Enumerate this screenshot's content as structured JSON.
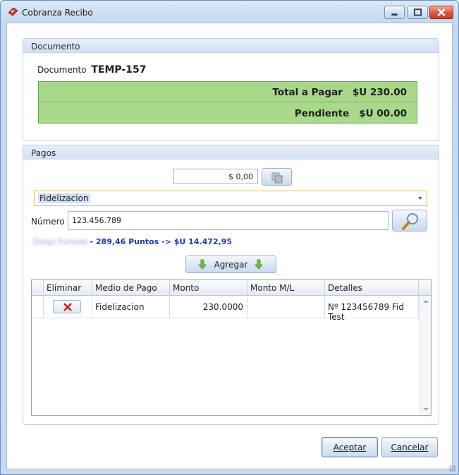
{
  "window": {
    "title": "Cobranza Recibo"
  },
  "documento": {
    "group_title": "Documento",
    "label": "Documento",
    "number": "TEMP-157",
    "total_label": "Total a Pagar",
    "total_value": "$U 230.00",
    "pending_label": "Pendiente",
    "pending_value": "$U 00.00"
  },
  "pagos": {
    "group_title": "Pagos",
    "amount": "$ 0,00",
    "medio_selected": "Fidelizacion",
    "numero_label": "Número",
    "numero_value": "123.456.789",
    "customer_name": "Diego Furtado",
    "points_text": "- 289,46 Puntos -> $U 14.472,95",
    "add_label": "Agregar",
    "grid": {
      "headers": [
        "Eliminar",
        "Medio de Pago",
        "Monto",
        "Monto M/L",
        "Detalles"
      ],
      "rows": [
        {
          "medio": "Fidelizacion",
          "monto": "230.0000",
          "monto_ml": "",
          "detalles": "Nº 123456789 Fid Test"
        }
      ]
    }
  },
  "actions": {
    "accept_label": "Aceptar",
    "cancel_label": "Cancelar"
  },
  "colors": {
    "total_panel": "#a8d88a",
    "points_text": "#1b38b8",
    "combo_border": "#e0bf55"
  },
  "icons": {
    "app": "receipt-icon",
    "minimize": "minimize-icon",
    "maximize": "maximize-icon",
    "close": "close-icon",
    "copy": "copy-icon",
    "search": "magnifier-icon",
    "add": "arrow-down-icon",
    "delete": "red-x-icon"
  }
}
